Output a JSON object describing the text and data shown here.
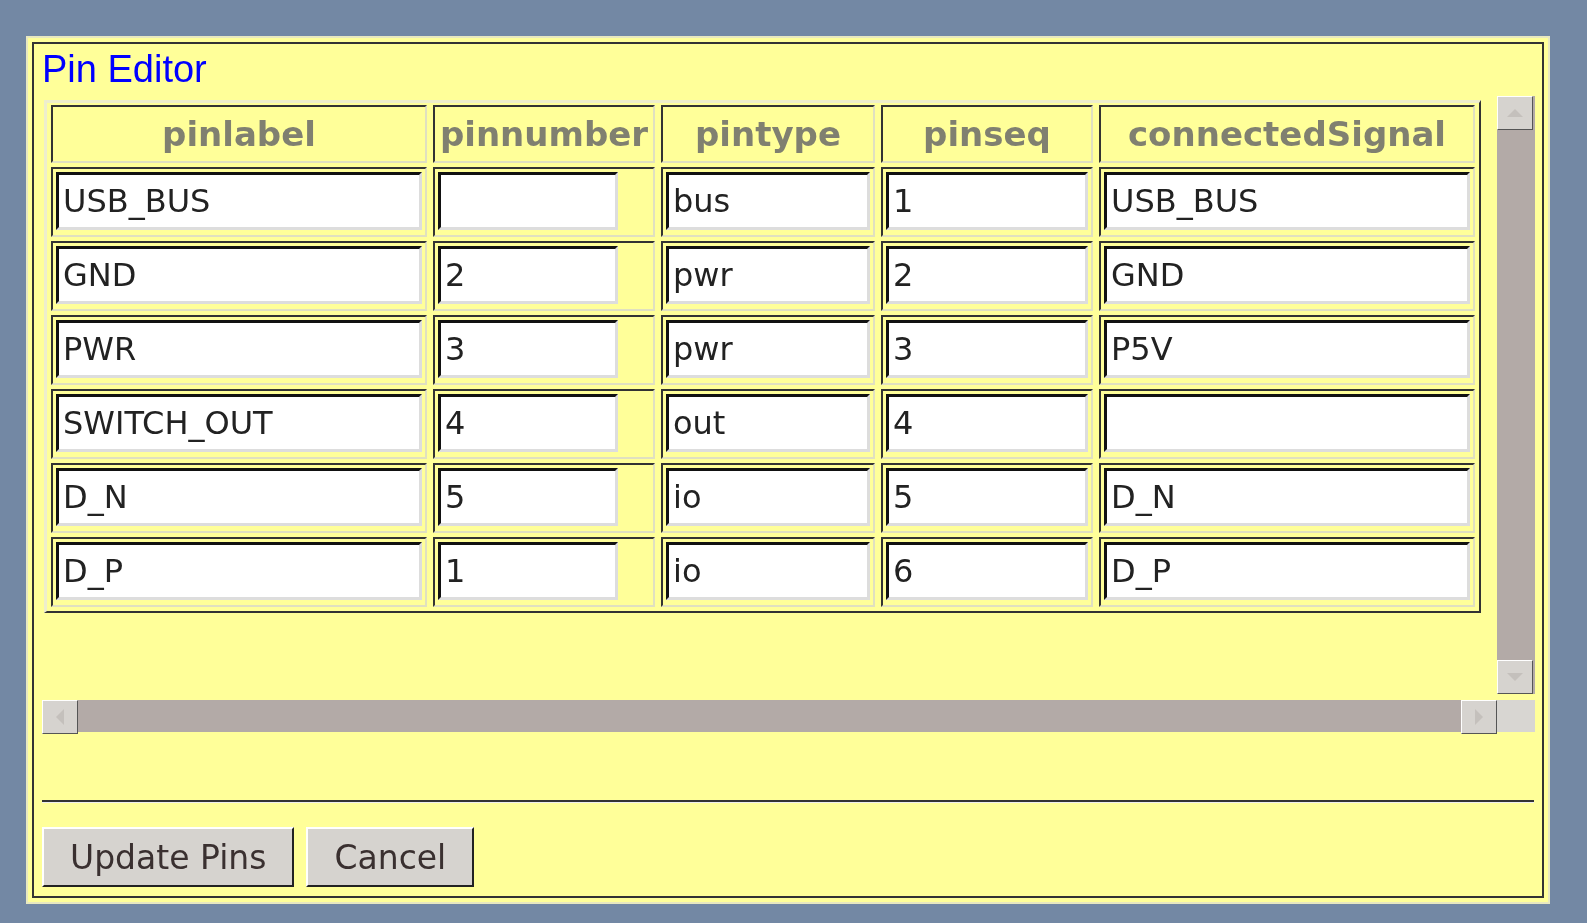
{
  "dialog": {
    "title": "Pin Editor"
  },
  "table": {
    "columns": [
      "pinlabel",
      "pinnumber",
      "pintype",
      "pinseq",
      "connectedSignal"
    ],
    "rows": [
      [
        "USB_BUS",
        null,
        "bus",
        "1",
        "USB_BUS"
      ],
      [
        "GND",
        "2",
        "pwr",
        "2",
        "GND"
      ],
      [
        "PWR",
        "3",
        "pwr",
        "3",
        "P5V"
      ],
      [
        "SWITCH_OUT",
        "4",
        "out",
        "4",
        null
      ],
      [
        "D_N",
        "5",
        "io",
        "5",
        "D_N"
      ],
      [
        "D_P",
        "1",
        "io",
        "6",
        "D_P"
      ]
    ]
  },
  "buttons": [
    "Update Pins",
    "Cancel"
  ]
}
